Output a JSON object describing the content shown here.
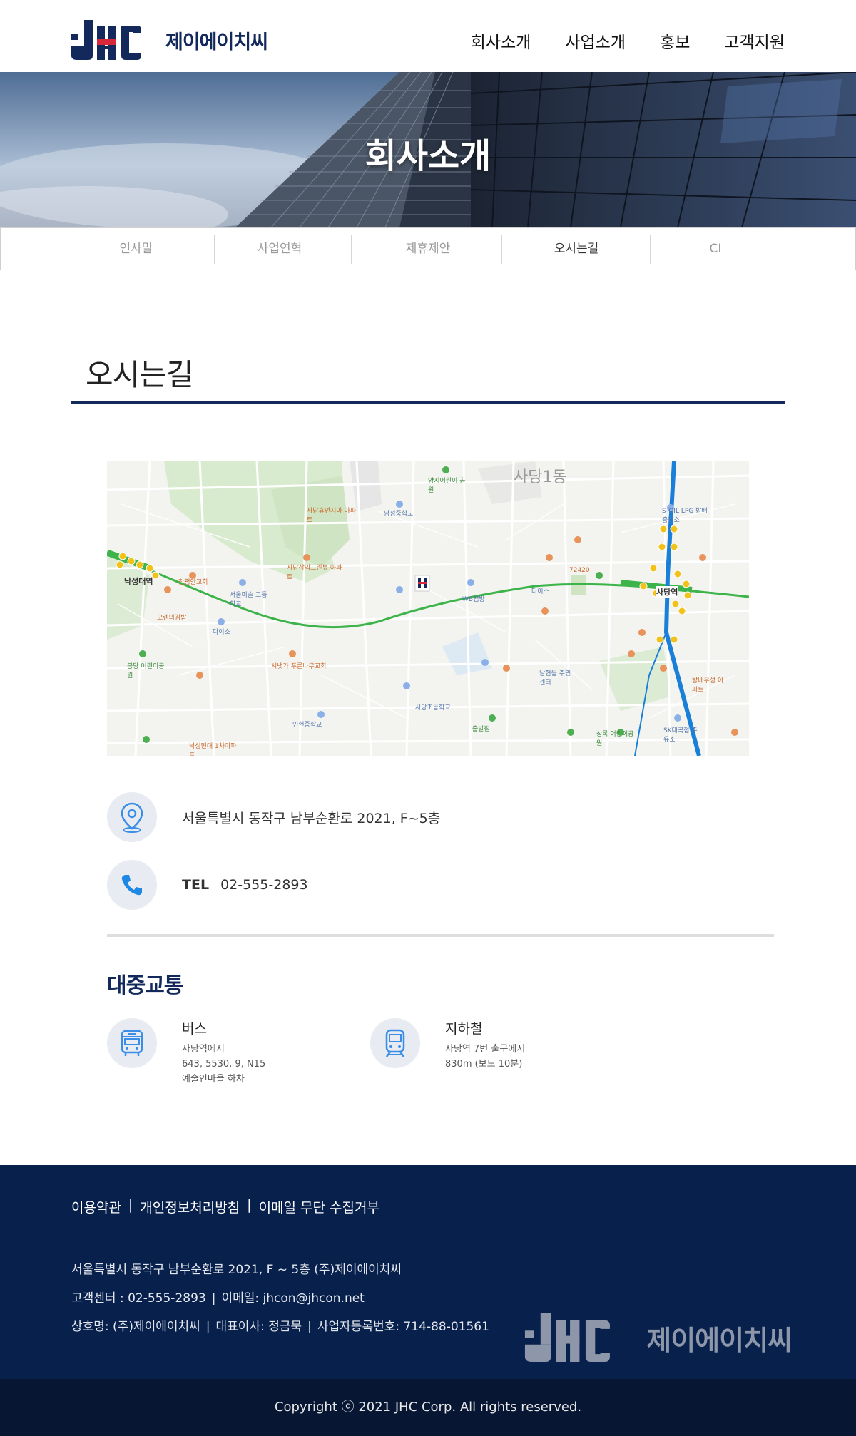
{
  "header": {
    "logo_text": "제이에이치씨",
    "nav": [
      "회사소개",
      "사업소개",
      "홍보",
      "고객지원"
    ]
  },
  "hero": {
    "title": "회사소개"
  },
  "subtabs": [
    "인사말",
    "사업연혁",
    "제휴제안",
    "오시는길",
    "CI"
  ],
  "active_subtab": "오시는길",
  "section": {
    "title": "오시는길"
  },
  "map": {
    "labels": {
      "district": "사당1동",
      "station_a": "낙성대역",
      "station_b": "사당역",
      "church": "참평안교회",
      "school_art": "서울미술 고등학교",
      "daiso_a": "다이소",
      "daiso_b": "다이소",
      "kids_park": "봉당 어린이공원",
      "riverside": "시냇가 푸른나무교회",
      "school_insun": "인헌중학교",
      "apt_nakseong": "낙성현대 1차아파트",
      "school_namseong": "남성중학교",
      "apt_a": "사당휴먼시아 아파트",
      "apt_b": "사당삼익그린뷰 아파트",
      "park_yangji": "양지어린이 공원",
      "wb": "WB랩방",
      "school_sadang": "사당초등학교",
      "exit": "출발점",
      "community": "남현동 주민센터",
      "kids_park2": "상록 어린이공원",
      "sk": "SK대곡점 주유소",
      "apt_bangbae": "방배우성 아파트",
      "soil": "S-OIL LPG 방배충전소",
      "gimbap": "오렌의김밥",
      "cafe": "72420"
    }
  },
  "contact": {
    "address": "서울특별시 동작구 남부순환로 2021, F~5층",
    "tel_label": "TEL",
    "tel": "02-555-2893"
  },
  "transit": {
    "title": "대중교통",
    "bus": {
      "name": "버스",
      "lines": [
        "사당역에서",
        "643, 5530, 9, N15",
        "예술인마을 하차"
      ]
    },
    "subway": {
      "name": "지하철",
      "lines": [
        "사당역 7번 출구에서",
        "830m (보도 10분)"
      ]
    }
  },
  "footer": {
    "links": [
      "이용약관",
      "개인정보처리방침",
      "이메일 무단 수집거부"
    ],
    "address_line": "서울특별시 동작구 남부순환로 2021, F ~ 5층 (주)제이에이치씨",
    "center_label": "고객센터 : 02-555-2893",
    "email_label": "이메일: jhcon@jhcon.net",
    "company_label": "상호명: (주)제이에이치씨",
    "ceo_label": "대표이사: 정금묵",
    "biz_label": "사업자등록번호: 714-88-01561",
    "logo_text": "제이에이치씨",
    "copyright": "Copyright ⓒ 2021 JHC Corp. All rights reserved."
  },
  "colors": {
    "brand_navy": "#13295c",
    "footer_bg": "#08204c",
    "copyright_bg": "#061633",
    "icon_blue": "#3a8ee6",
    "subway_line_green": "#3cb44a",
    "subway_line_blue": "#1a7fd8"
  },
  "icons": {
    "address": "map-pin-icon",
    "tel": "phone-icon",
    "bus": "bus-icon",
    "subway": "subway-train-icon"
  }
}
